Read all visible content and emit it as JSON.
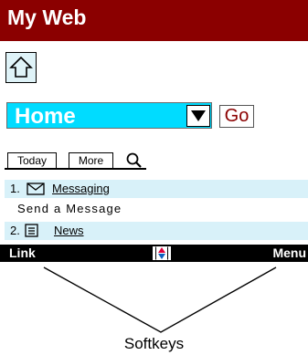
{
  "header": {
    "title": "My Web"
  },
  "address": {
    "value": "Home",
    "go_label": "Go"
  },
  "tabs": [
    {
      "label": "Today"
    },
    {
      "label": "More"
    }
  ],
  "list": [
    {
      "number": "1.",
      "icon": "envelope-icon",
      "label": "Messaging"
    },
    {
      "sub": "Send a Message"
    },
    {
      "number": "2.",
      "icon": "list-icon",
      "label": "News"
    }
  ],
  "softkeys": {
    "left": "Link",
    "right": "Menu"
  },
  "annotation": {
    "caption": "Softkeys"
  },
  "colors": {
    "titlebar": "#8b0000",
    "combo": "#00dcff",
    "row_highlight": "#d8f1f9",
    "go_text": "#8b0000"
  }
}
